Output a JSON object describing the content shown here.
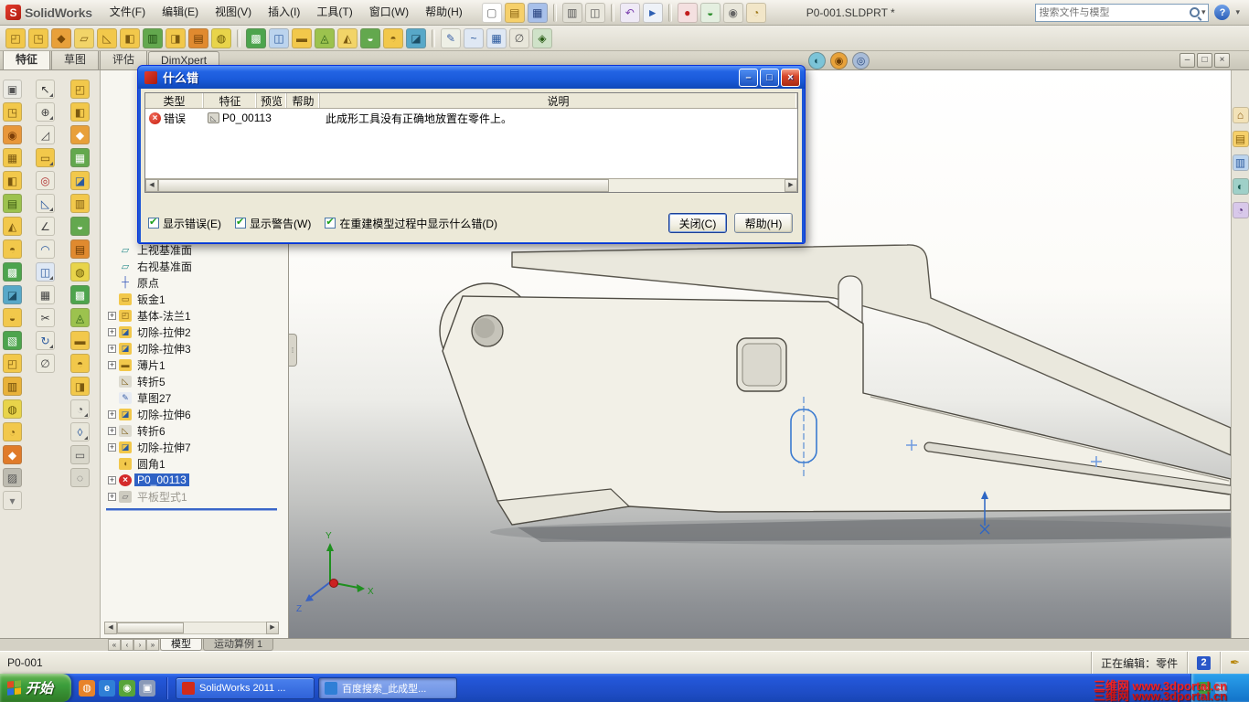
{
  "app": {
    "logo_letter": "S",
    "logo_text": "SolidWorks"
  },
  "titlebar": {
    "menus": [
      "文件(F)",
      "编辑(E)",
      "视图(V)",
      "插入(I)",
      "工具(T)",
      "窗口(W)",
      "帮助(H)"
    ],
    "tools": [
      {
        "n": "new-document",
        "g": "▢",
        "c": "#ffffff",
        "f": "#6b6b6b"
      },
      {
        "n": "open",
        "g": "▤",
        "c": "#f6d06a",
        "f": "#8a6410"
      },
      {
        "n": "save",
        "g": "▦",
        "c": "#a8c0ea",
        "f": "#26417e"
      },
      {
        "sep": true
      },
      {
        "n": "print",
        "g": "▥",
        "c": "#e2e0d6",
        "f": "#555555"
      },
      {
        "n": "print-preview",
        "g": "◫",
        "c": "#e9e7dd",
        "f": "#555555"
      },
      {
        "sep": true
      },
      {
        "n": "undo",
        "g": "↶",
        "c": "#efeaf6",
        "f": "#7a3fae"
      },
      {
        "n": "select",
        "g": "►",
        "c": "#eef2f8",
        "f": "#2d5fb3"
      },
      {
        "sep": true
      },
      {
        "n": "macro-record",
        "g": "●",
        "c": "#f4e0e0",
        "f": "#c21d1d"
      },
      {
        "n": "rebuild",
        "g": "◒",
        "c": "#e4efe0",
        "f": "#2f8f2f"
      },
      {
        "n": "options",
        "g": "◉",
        "c": "#e9e7db",
        "f": "#666666"
      },
      {
        "n": "edit-color",
        "g": "◔",
        "c": "#f2e6c8",
        "f": "#a07a1a"
      }
    ],
    "doc_title": "P0-001.SLDPRT *",
    "search_placeholder": "搜索文件与模型",
    "help_label": "?",
    "chevron": "▾"
  },
  "toolbar2": {
    "icons": [
      {
        "g": "◰",
        "c": "#f2c84b",
        "f": "#7c5a10"
      },
      {
        "g": "◳",
        "c": "#f2c84b",
        "f": "#7c5a10"
      },
      {
        "g": "◆",
        "c": "#e8a03a",
        "f": "#7c4a08"
      },
      {
        "g": "▱",
        "c": "#f2d468",
        "f": "#7c5a10"
      },
      {
        "g": "◺",
        "c": "#f2c84b",
        "f": "#7c5a10"
      },
      {
        "g": "◧",
        "c": "#f2c84b",
        "f": "#7c5a10"
      },
      {
        "g": "▥",
        "c": "#63a84e",
        "f": "#1e4d12"
      },
      {
        "g": "◨",
        "c": "#f2c84b",
        "f": "#7c5a10"
      },
      {
        "g": "▤",
        "c": "#e08a2f",
        "f": "#6b3c05"
      },
      {
        "g": "◍",
        "c": "#e8d44a",
        "f": "#6b5a08"
      },
      {
        "sep": true
      },
      {
        "g": "▩",
        "c": "#4da44d",
        "f": "#ffffff"
      },
      {
        "g": "◫",
        "c": "#bcd4ee",
        "f": "#2c5a9e"
      },
      {
        "g": "▬",
        "c": "#f2c84b",
        "f": "#7c5a10"
      },
      {
        "g": "◬",
        "c": "#9cc24e",
        "f": "#2a5d16"
      },
      {
        "g": "◭",
        "c": "#f2d468",
        "f": "#7c5a10"
      },
      {
        "g": "◒",
        "c": "#63a84e",
        "f": "#ffffff"
      },
      {
        "g": "◓",
        "c": "#f2c84b",
        "f": "#7c5a10"
      },
      {
        "g": "◪",
        "c": "#58a8c8",
        "f": "#1c4e66"
      },
      {
        "sep": true
      },
      {
        "g": "✎",
        "c": "#eef0e6",
        "f": "#3b62a8"
      },
      {
        "g": "~",
        "c": "#dfe8f4",
        "f": "#2c5a9e"
      },
      {
        "g": "▦",
        "c": "#dfe8f4",
        "f": "#2c5a9e"
      },
      {
        "g": "∅",
        "c": "#e8e6da",
        "f": "#555555"
      },
      {
        "g": "◈",
        "c": "#cfe2c8",
        "f": "#2a5d16"
      }
    ]
  },
  "command_tabs": {
    "items": [
      {
        "label": "特征",
        "active": true
      },
      {
        "label": "草图"
      },
      {
        "label": "评估"
      },
      {
        "label": "DimXpert"
      }
    ]
  },
  "headsup": {
    "icons": [
      {
        "n": "apply-scene",
        "g": "◐",
        "c": "#7cc4d8",
        "f": "#14505e"
      },
      {
        "n": "appearances",
        "g": "◉",
        "c": "#e8a23a",
        "f": "#6b3c05"
      },
      {
        "n": "view-settings",
        "g": "◎",
        "c": "#a8bcd8",
        "f": "#2c4a7e"
      }
    ],
    "window_buttons": [
      {
        "n": "minimize-document",
        "g": "–"
      },
      {
        "n": "restore-document",
        "g": "□"
      },
      {
        "n": "close-document",
        "g": "×"
      }
    ]
  },
  "left_toolbars": {
    "col1": [
      {
        "g": "▣",
        "c": "#ecebe4",
        "f": "#555555"
      },
      {
        "g": "◳",
        "c": "#f2c84b",
        "f": "#7c5a10"
      },
      {
        "g": "◉",
        "c": "#e8973a",
        "f": "#7c3e08"
      },
      {
        "g": "▦",
        "c": "#f2c84b",
        "f": "#7c5a10"
      },
      {
        "g": "◧",
        "c": "#f2c84b",
        "f": "#7c5a10"
      },
      {
        "g": "▤",
        "c": "#9cc24e",
        "f": "#3e5c12"
      },
      {
        "g": "◭",
        "c": "#f2c84b",
        "f": "#7c5a10"
      },
      {
        "g": "◓",
        "c": "#f2c84b",
        "f": "#7c5a10"
      },
      {
        "g": "▩",
        "c": "#4da44d",
        "f": "#ffffff"
      },
      {
        "g": "◪",
        "c": "#58a8c8",
        "f": "#1c4e66"
      },
      {
        "g": "◒",
        "c": "#f2c84b",
        "f": "#7c5a10"
      },
      {
        "g": "▧",
        "c": "#4da44d",
        "f": "#ffffff"
      },
      {
        "g": "◰",
        "c": "#f2c84b",
        "f": "#7c5a10"
      },
      {
        "g": "▥",
        "c": "#e8b23a",
        "f": "#6b4a08"
      },
      {
        "g": "◍",
        "c": "#e8d44a",
        "f": "#6b5a08"
      },
      {
        "g": "◔",
        "c": "#f2c84b",
        "f": "#7c5a10"
      },
      {
        "g": "◆",
        "c": "#e07b2a",
        "f": "#ffffff"
      },
      {
        "g": "▨",
        "c": "#bdbbb0",
        "f": "#555555"
      },
      {
        "g": "▾",
        "c": "#e9e6dc",
        "f": "#777777"
      }
    ],
    "col2": [
      {
        "g": "↖",
        "c": "#eceade",
        "f": "#333333",
        "fly": true
      },
      {
        "g": "⊕",
        "c": "#eceade",
        "f": "#444444",
        "fly": true
      },
      {
        "g": "◿",
        "c": "#eceade",
        "f": "#444444"
      },
      {
        "g": "▭",
        "c": "#f2c84b",
        "f": "#7c5a10",
        "fly": true
      },
      {
        "g": "◎",
        "c": "#eceade",
        "f": "#b03030"
      },
      {
        "g": "◺",
        "c": "#eceade",
        "f": "#2c5a9e",
        "fly": true
      },
      {
        "g": "∠",
        "c": "#eceade",
        "f": "#444444"
      },
      {
        "g": "◠",
        "c": "#eceade",
        "f": "#2c5a9e"
      },
      {
        "g": "◫",
        "c": "#dfe8f4",
        "f": "#2c5a9e",
        "fly": true
      },
      {
        "g": "▦",
        "c": "#eceade",
        "f": "#444444"
      },
      {
        "g": "✂",
        "c": "#eceade",
        "f": "#444444"
      },
      {
        "g": "↻",
        "c": "#eceade",
        "f": "#2c5a9e",
        "fly": true
      },
      {
        "g": "∅",
        "c": "#eceade",
        "f": "#444444"
      }
    ],
    "col3": [
      {
        "g": "◰",
        "c": "#f2c84b",
        "f": "#7c5a10"
      },
      {
        "g": "◧",
        "c": "#f2c84b",
        "f": "#7c5a10"
      },
      {
        "g": "◆",
        "c": "#e8a03a",
        "f": "#ffffff"
      },
      {
        "g": "▦",
        "c": "#63a84e",
        "f": "#ffffff"
      },
      {
        "g": "◪",
        "c": "#f2c84b",
        "f": "#2c5a9e"
      },
      {
        "g": "▥",
        "c": "#f2c84b",
        "f": "#7c5a10"
      },
      {
        "g": "◒",
        "c": "#63a84e",
        "f": "#ffffff"
      },
      {
        "g": "▤",
        "c": "#e08a2f",
        "f": "#6b3c05"
      },
      {
        "g": "◍",
        "c": "#e8d44a",
        "f": "#6b5a08"
      },
      {
        "g": "▩",
        "c": "#4da44d",
        "f": "#ffffff"
      },
      {
        "g": "◬",
        "c": "#9cc24e",
        "f": "#2a5d16"
      },
      {
        "g": "▬",
        "c": "#f2c84b",
        "f": "#7c5a10"
      },
      {
        "g": "◓",
        "c": "#f2c84b",
        "f": "#7c5a10"
      },
      {
        "g": "◨",
        "c": "#f2c84b",
        "f": "#7c5a10"
      },
      {
        "g": "◔",
        "c": "#e8e6da",
        "f": "#555555",
        "fly": true
      },
      {
        "g": "◊",
        "c": "#e8e6da",
        "f": "#2c5a9e",
        "fly": true
      },
      {
        "g": "▭",
        "c": "#d9d7cb",
        "f": "#555555"
      },
      {
        "g": "◌",
        "c": "#d9d7cb",
        "f": "#555555"
      }
    ]
  },
  "feature_tree": {
    "items": [
      {
        "label": "上视基准面",
        "icon": "plane"
      },
      {
        "label": "右视基准面",
        "icon": "plane"
      },
      {
        "label": "原点",
        "icon": "origin"
      },
      {
        "label": "钣金1",
        "icon": "sheetmetal"
      },
      {
        "label": "基体-法兰1",
        "icon": "flange",
        "expand": true
      },
      {
        "label": "切除-拉伸2",
        "icon": "cut",
        "expand": true
      },
      {
        "label": "切除-拉伸3",
        "icon": "cut",
        "expand": true
      },
      {
        "label": "薄片1",
        "icon": "tab",
        "expand": true
      },
      {
        "label": "转折5",
        "icon": "jog"
      },
      {
        "label": "草图27",
        "icon": "sketch"
      },
      {
        "label": "切除-拉伸6",
        "icon": "cut",
        "expand": true
      },
      {
        "label": "转折6",
        "icon": "jog",
        "expand": true
      },
      {
        "label": "切除-拉伸7",
        "icon": "cut",
        "expand": true
      },
      {
        "label": "圆角1",
        "icon": "fillet"
      },
      {
        "label": "P0_00113",
        "icon": "error",
        "selected": true,
        "expand": true
      },
      {
        "label": "平板型式1",
        "icon": "flatpattern",
        "dim": true,
        "expand": true
      }
    ]
  },
  "dialog": {
    "title": "什么错",
    "window_buttons": [
      {
        "n": "dialog-minimize",
        "g": "–"
      },
      {
        "n": "dialog-maximize",
        "g": "□"
      },
      {
        "n": "dialog-close",
        "g": "×",
        "close": true
      }
    ],
    "columns": [
      "类型",
      "特征",
      "预览",
      "帮助",
      "说明"
    ],
    "rows": [
      {
        "type": "错误",
        "feature": "P0_00113",
        "description": "此成形工具没有正确地放置在零件上。"
      }
    ],
    "checkboxes": [
      {
        "label": "显示错误(E)",
        "checked": true
      },
      {
        "label": "显示警告(W)",
        "checked": true
      },
      {
        "label": "在重建模型过程中显示什么错(D)",
        "checked": true
      }
    ],
    "buttons": [
      {
        "label": "关闭(C)",
        "default": true
      },
      {
        "label": "帮助(H)"
      }
    ]
  },
  "taskpane": {
    "icons": [
      {
        "n": "home",
        "g": "⌂",
        "c": "#f2e2b8",
        "f": "#8a5a10"
      },
      {
        "n": "design-library",
        "g": "▤",
        "c": "#f6d06a",
        "f": "#8a6410"
      },
      {
        "n": "file-explorer",
        "g": "▥",
        "c": "#bcd4ee",
        "f": "#2c5a9e"
      },
      {
        "n": "appearances",
        "g": "◐",
        "c": "#9fd0c8",
        "f": "#1c5e56"
      },
      {
        "n": "custom-properties",
        "g": "◔",
        "c": "#d8c8ea",
        "f": "#55307c"
      }
    ]
  },
  "viewport": {
    "triad": {
      "x": "X",
      "y": "Y",
      "z": "Z"
    }
  },
  "bottom_tabs": {
    "nav": [
      "«",
      "‹",
      "›",
      "»"
    ],
    "items": [
      {
        "label": "模型",
        "active": true
      },
      {
        "label": "运动算例 1"
      }
    ]
  },
  "statusbar": {
    "left": "P0-001",
    "editing": "正在编辑：零件",
    "badge": "2"
  },
  "taskbar": {
    "start": "开始",
    "quick_launch": [
      {
        "n": "launch-browser",
        "g": "◍",
        "c": "#e8832a"
      },
      {
        "n": "launch-ie",
        "g": "e",
        "c": "#2f7fd6"
      },
      {
        "n": "launch-media",
        "g": "◉",
        "c": "#58a43a"
      },
      {
        "n": "show-desktop",
        "g": "▣",
        "c": "#8a9ab8"
      }
    ],
    "tasks": [
      {
        "label": "SolidWorks 2011 ...",
        "icon": "sw"
      },
      {
        "label": "百度搜索_此成型...",
        "icon": "ie",
        "active": true
      }
    ],
    "tray_icons": [
      {
        "n": "tray-shield",
        "g": "◈",
        "c": "#3e9e3e"
      },
      {
        "n": "tray-volume",
        "g": "◉",
        "c": "#6aa8e0"
      }
    ],
    "watermark": "三维网 www.3dportal.cn"
  }
}
